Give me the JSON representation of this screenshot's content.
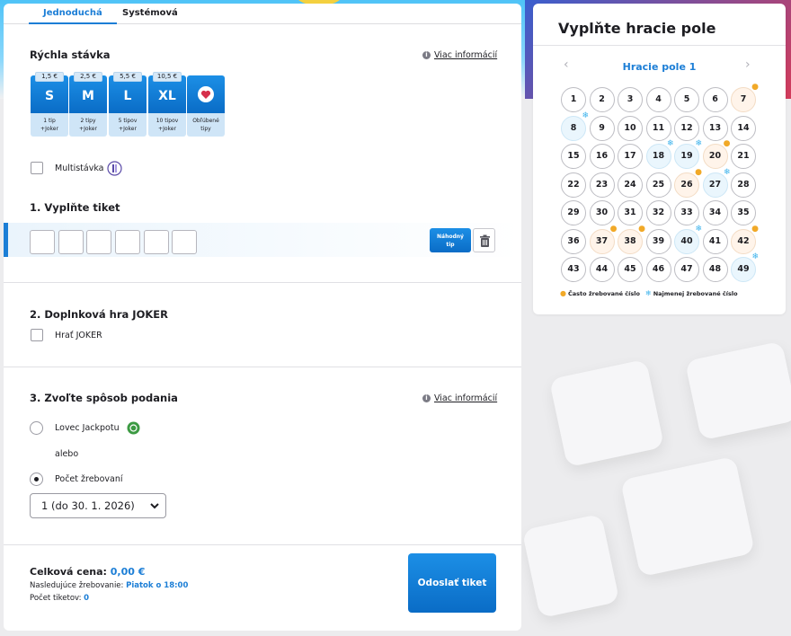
{
  "colors": {
    "accent": "#1c7ed6",
    "hot": "#f1a928",
    "cold": "#3bb2ec"
  },
  "tabs": [
    {
      "label": "Jednoduchá",
      "active": true
    },
    {
      "label": "Systémová",
      "active": false
    }
  ],
  "quick_bet": {
    "title": "Rýchla stávka",
    "info_link": "Viac informácií",
    "options": [
      {
        "price": "1,5 €",
        "size": "S",
        "line1": "1 tip",
        "line2": "+Joker"
      },
      {
        "price": "2,5 €",
        "size": "M",
        "line1": "2 tipy",
        "line2": "+Joker"
      },
      {
        "price": "5,5 €",
        "size": "L",
        "line1": "5 tipov",
        "line2": "+Joker"
      },
      {
        "price": "10,5 €",
        "size": "XL",
        "line1": "10 tipov",
        "line2": "+Joker"
      }
    ],
    "favorite": {
      "line1": "Obľúbené",
      "line2": "tipy",
      "icon": "heart-icon"
    },
    "multi_label": "Multistávka"
  },
  "ticket": {
    "title": "1. Vyplňte tiket",
    "random_btn_line1": "Náhodný",
    "random_btn_line2": "tip",
    "cells": [
      "",
      "",
      "",
      "",
      "",
      ""
    ]
  },
  "joker": {
    "title": "2. Doplnková hra JOKER",
    "checkbox_label": "Hrať JOKER"
  },
  "submission": {
    "title": "3. Zvoľte spôsob podania",
    "info_link": "Viac informácií",
    "option1": "Lovec Jackpotu",
    "or": "alebo",
    "option2": "Počet žrebovaní",
    "select_value": "1 (do 30. 1. 2026)"
  },
  "footer": {
    "total_label": "Celková cena:",
    "total_value": "0,00 €",
    "next_label": "Nasledujúce žrebovanie:",
    "next_value": "Piatok o 18:00",
    "count_label": "Počet tiketov:",
    "count_value": "0",
    "send_button": "Odoslať tiket"
  },
  "board": {
    "title": "Vyplňte hracie pole",
    "field_label": "Hracie pole 1",
    "prev_arrow": "‹",
    "next_arrow": "›",
    "numbers": [
      {
        "n": "1",
        "m": ""
      },
      {
        "n": "2",
        "m": ""
      },
      {
        "n": "3",
        "m": ""
      },
      {
        "n": "4",
        "m": ""
      },
      {
        "n": "5",
        "m": ""
      },
      {
        "n": "6",
        "m": ""
      },
      {
        "n": "7",
        "m": "hot"
      },
      {
        "n": "8",
        "m": "cold"
      },
      {
        "n": "9",
        "m": ""
      },
      {
        "n": "10",
        "m": ""
      },
      {
        "n": "11",
        "m": ""
      },
      {
        "n": "12",
        "m": ""
      },
      {
        "n": "13",
        "m": ""
      },
      {
        "n": "14",
        "m": ""
      },
      {
        "n": "15",
        "m": ""
      },
      {
        "n": "16",
        "m": ""
      },
      {
        "n": "17",
        "m": ""
      },
      {
        "n": "18",
        "m": "cold"
      },
      {
        "n": "19",
        "m": "cold"
      },
      {
        "n": "20",
        "m": "hot"
      },
      {
        "n": "21",
        "m": ""
      },
      {
        "n": "22",
        "m": ""
      },
      {
        "n": "23",
        "m": ""
      },
      {
        "n": "24",
        "m": ""
      },
      {
        "n": "25",
        "m": ""
      },
      {
        "n": "26",
        "m": "hot"
      },
      {
        "n": "27",
        "m": "cold"
      },
      {
        "n": "28",
        "m": ""
      },
      {
        "n": "29",
        "m": ""
      },
      {
        "n": "30",
        "m": ""
      },
      {
        "n": "31",
        "m": ""
      },
      {
        "n": "32",
        "m": ""
      },
      {
        "n": "33",
        "m": ""
      },
      {
        "n": "34",
        "m": ""
      },
      {
        "n": "35",
        "m": ""
      },
      {
        "n": "36",
        "m": ""
      },
      {
        "n": "37",
        "m": "hot"
      },
      {
        "n": "38",
        "m": "hot"
      },
      {
        "n": "39",
        "m": ""
      },
      {
        "n": "40",
        "m": "cold"
      },
      {
        "n": "41",
        "m": ""
      },
      {
        "n": "42",
        "m": "hot"
      },
      {
        "n": "43",
        "m": ""
      },
      {
        "n": "44",
        "m": ""
      },
      {
        "n": "45",
        "m": ""
      },
      {
        "n": "46",
        "m": ""
      },
      {
        "n": "47",
        "m": ""
      },
      {
        "n": "48",
        "m": ""
      },
      {
        "n": "49",
        "m": "cold"
      }
    ],
    "legend_hot": "Často žrebované číslo",
    "legend_cold": "Najmenej žrebované číslo"
  }
}
